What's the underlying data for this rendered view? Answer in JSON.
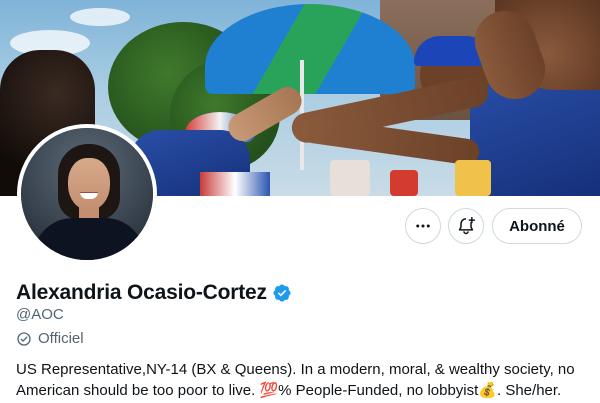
{
  "profile": {
    "name": "Alexandria Ocasio-Cortez",
    "handle": "@AOC",
    "official_label": "Officiel",
    "bio_part1": "US Representative,NY-14 (BX & Queens). In a modern, moral, & wealthy society, no American should be too poor to live. ",
    "bio_emoji_100": "💯",
    "bio_part2": "% People-Funded, no lobbyist",
    "bio_emoji_money": "💰",
    "bio_part3": ". She/her."
  },
  "actions": {
    "more_label": "More options",
    "notify_label": "Turn on notifications",
    "following_label": "Abonné"
  },
  "colors": {
    "verified": "#1d9bf0",
    "secondary_text": "#536471",
    "border": "#cfd9de"
  },
  "icons": {
    "more": "more-dots-icon",
    "notify": "bell-plus-icon",
    "verified": "verified-badge-icon",
    "official": "official-check-icon"
  }
}
